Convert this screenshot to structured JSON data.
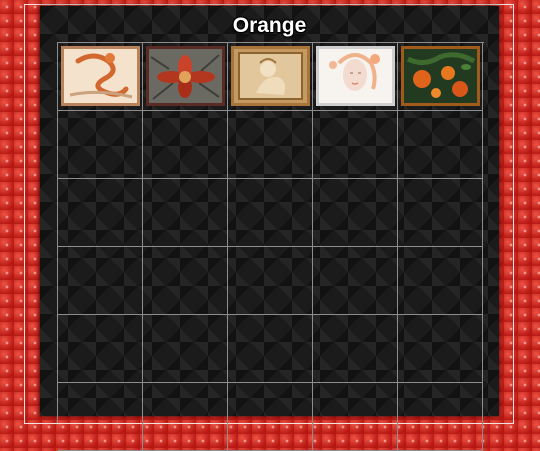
{
  "page": {
    "title": "Orange"
  },
  "thumbnails": [
    {
      "icon": "dragon-art-icon"
    },
    {
      "icon": "flower-art-icon"
    },
    {
      "icon": "carved-figure-icon"
    },
    {
      "icon": "woman-portrait-icon"
    },
    {
      "icon": "orange-fruit-icon"
    }
  ],
  "colors": {
    "background": "#d8241c",
    "panel": "#1b1b1b",
    "grid_line": "#8d8d8d"
  }
}
